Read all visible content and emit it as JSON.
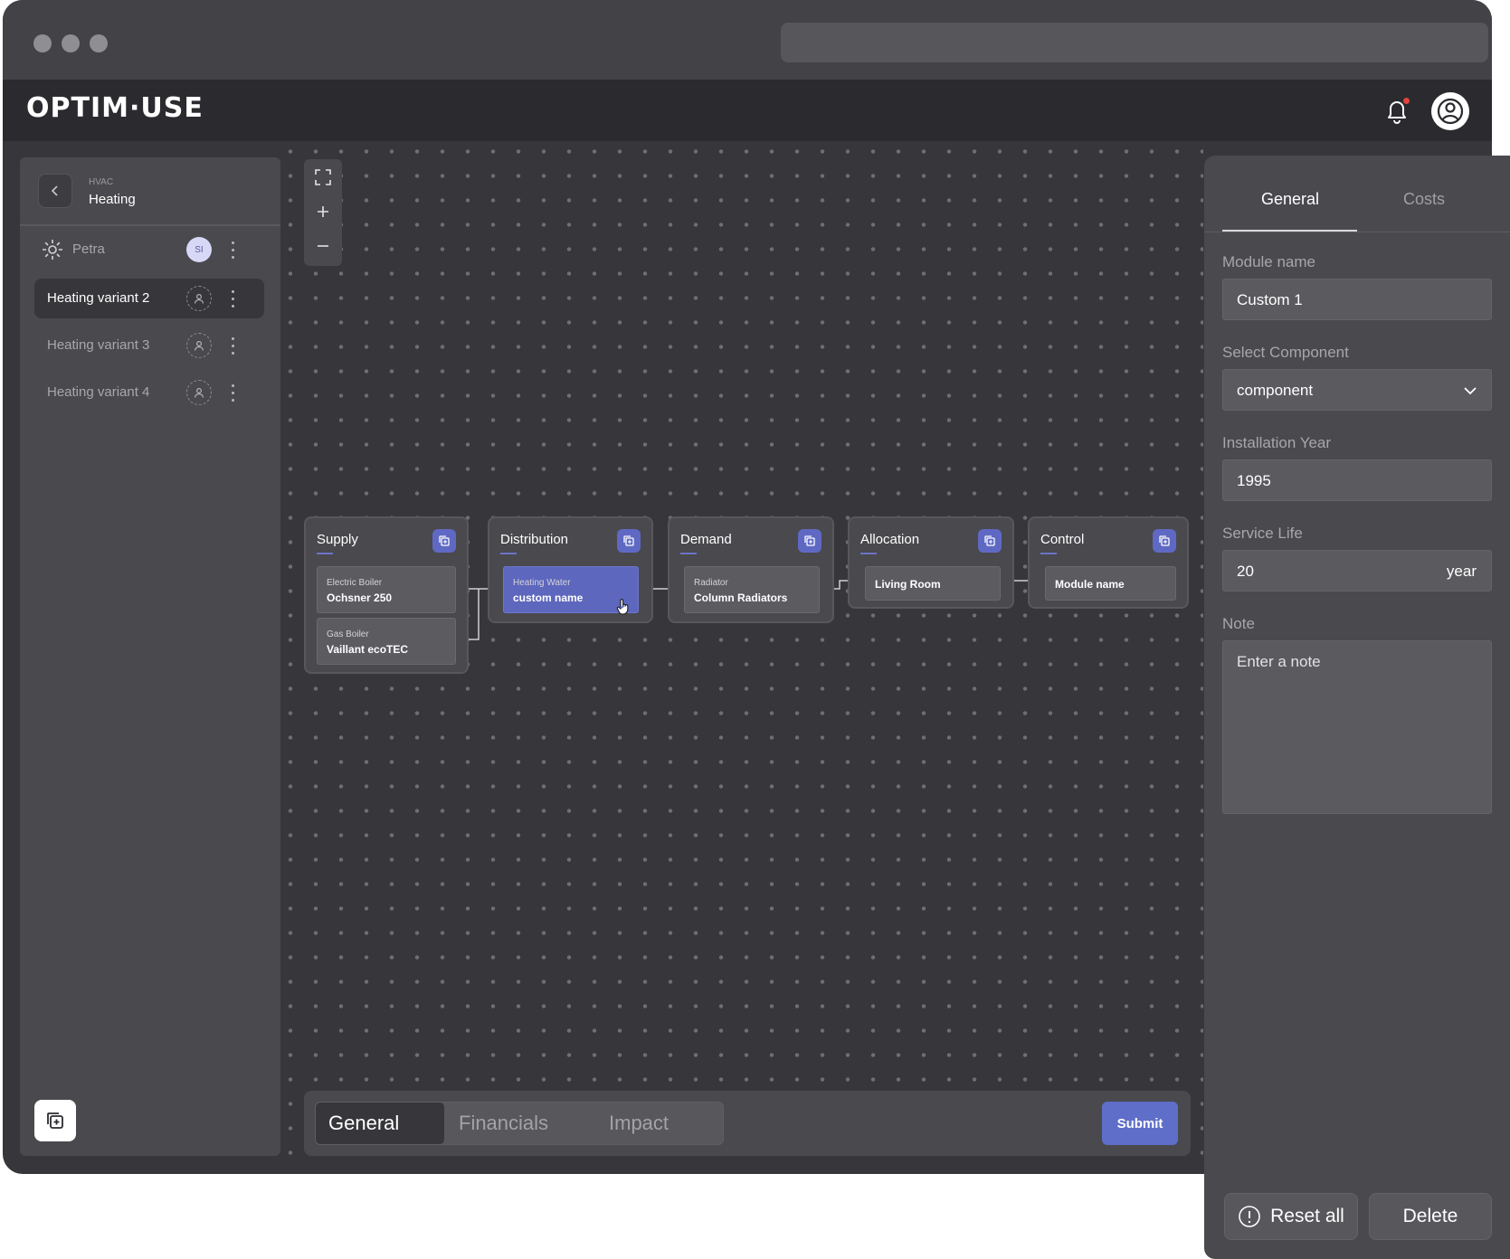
{
  "brand": {
    "logo": "OPTIM·USE"
  },
  "sidebar": {
    "category": "HVAC",
    "title": "Heating",
    "items": [
      {
        "label": "Petra",
        "badge": "SI"
      },
      {
        "label": "Heating variant 2"
      },
      {
        "label": "Heating variant 3"
      },
      {
        "label": "Heating variant 4"
      }
    ]
  },
  "flow": {
    "modules": [
      {
        "title": "Supply",
        "cards": [
          {
            "type": "Electric Boiler",
            "name": "Ochsner 250"
          },
          {
            "type": "Gas Boiler",
            "name": "Vaillant ecoTEC"
          }
        ]
      },
      {
        "title": "Distribution",
        "cards": [
          {
            "type": "Heating Water",
            "name": "custom name"
          }
        ]
      },
      {
        "title": "Demand",
        "cards": [
          {
            "type": "Radiator",
            "name": "Column Radiators"
          }
        ]
      },
      {
        "title": "Allocation",
        "cards": [
          {
            "name": "Living Room"
          }
        ]
      },
      {
        "title": "Control",
        "cards": [
          {
            "name": "Module name"
          }
        ]
      }
    ]
  },
  "bottom": {
    "tabs": [
      "General",
      "Financials",
      "Impact"
    ],
    "submit": "Submit"
  },
  "panel": {
    "tabs": [
      "General",
      "Costs"
    ],
    "module_name_label": "Module name",
    "module_name_value": "Custom 1",
    "component_label": "Select Component",
    "component_value": "component",
    "year_label": "Installation Year",
    "year_value": "1995",
    "life_label": "Service Life",
    "life_value": "20",
    "life_unit": "year",
    "note_label": "Note",
    "note_placeholder": "Enter a note",
    "reset_label": "Reset all",
    "delete_label": "Delete"
  },
  "colors": {
    "accent": "#5f6ec9",
    "background": "#37363a",
    "panel": "#4a494d",
    "notification": "#e0443a"
  }
}
